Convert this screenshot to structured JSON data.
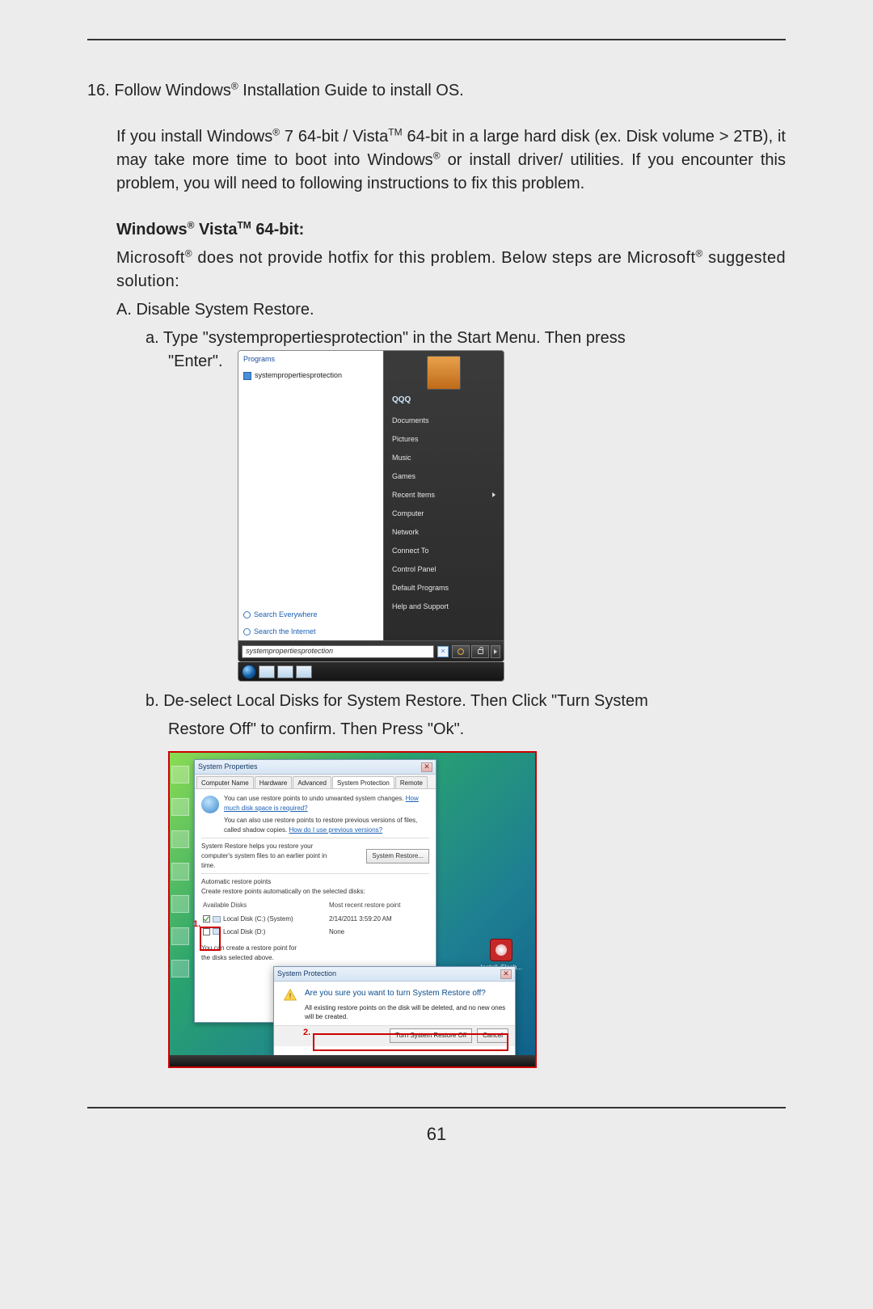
{
  "step_number": "16.",
  "step_text_pre": "Follow Windows",
  "step_text_post": " Installation Guide to install OS.",
  "reg": "®",
  "tm": "TM",
  "note_1a": "If you install Windows",
  "note_1b": " 7 64-bit / Vista",
  "note_1c": " 64-bit in a large hard disk (ex. Disk volume > 2TB), it may take more time to boot into Windows",
  "note_1d": " or install driver/ utilities. If you encounter this problem, you will need to following instructions to fix this problem.",
  "heading_pre": "Windows",
  "heading_mid": " Vista",
  "heading_post": " 64-bit:",
  "ms_line_1a": "Microsoft",
  "ms_line_1b": " does not provide hotfix for this problem. Below steps are Microsoft",
  "ms_line_1c": " suggested solution:",
  "letterA": "A. Disable System Restore.",
  "sub_a": "a. Type \"systempropertiesprotection\" in the Start Menu. Then press",
  "enter_quoted": "\"Enter\".",
  "sub_b": "b. De-select Local Disks for System Restore. Then Click \"Turn System",
  "sub_b2": "Restore Off\" to confirm. Then Press \"Ok\".",
  "page_number": "61",
  "startmenu": {
    "programs_header": "Programs",
    "result": "systempropertiesprotection",
    "search_everywhere": "Search Everywhere",
    "search_internet": "Search the Internet",
    "user": "QQQ",
    "items": [
      "Documents",
      "Pictures",
      "Music",
      "Games",
      "Recent Items",
      "Computer",
      "Network",
      "Connect To",
      "Control Panel",
      "Default Programs",
      "Help and Support"
    ],
    "recent_has_sub": true,
    "search_value": "systempropertiesprotection"
  },
  "sysprop": {
    "window_title": "System Properties",
    "tabs": [
      "Computer Name",
      "Hardware",
      "Advanced",
      "System Protection",
      "Remote"
    ],
    "active_tab_index": 3,
    "intro_a": "You can use restore points to undo unwanted system changes. ",
    "intro_link_a": "How much disk space is required?",
    "intro_b": "You can also use restore points to restore previous versions of files, called shadow copies. ",
    "intro_link_b": "How do I use previous versions?",
    "restore_help": "System Restore helps you restore your computer's system files to an earlier point in time.",
    "restore_btn": "System Restore...",
    "auto_hdr": "Automatic restore points",
    "auto_sub": "Create restore points automatically on the selected disks:",
    "col_a": "Available Disks",
    "col_b": "Most recent restore point",
    "disk_c": "Local Disk (C:) (System)",
    "disk_c_val": "2/14/2011 3:59:20 AM",
    "disk_d": "Local Disk (D:)",
    "disk_d_val": "None",
    "create_text": "You can create a restore point for the disks selected above.",
    "label1": "1.",
    "label2": "2.",
    "flash_label": "Install_Flash..."
  },
  "confirm": {
    "title": "System Protection",
    "question": "Are you sure you want to turn System Restore off?",
    "detail": "All existing restore points on the disk will be deleted, and no new ones will be created.",
    "btn_off": "Turn System Restore Off",
    "btn_cancel": "Cancel"
  }
}
